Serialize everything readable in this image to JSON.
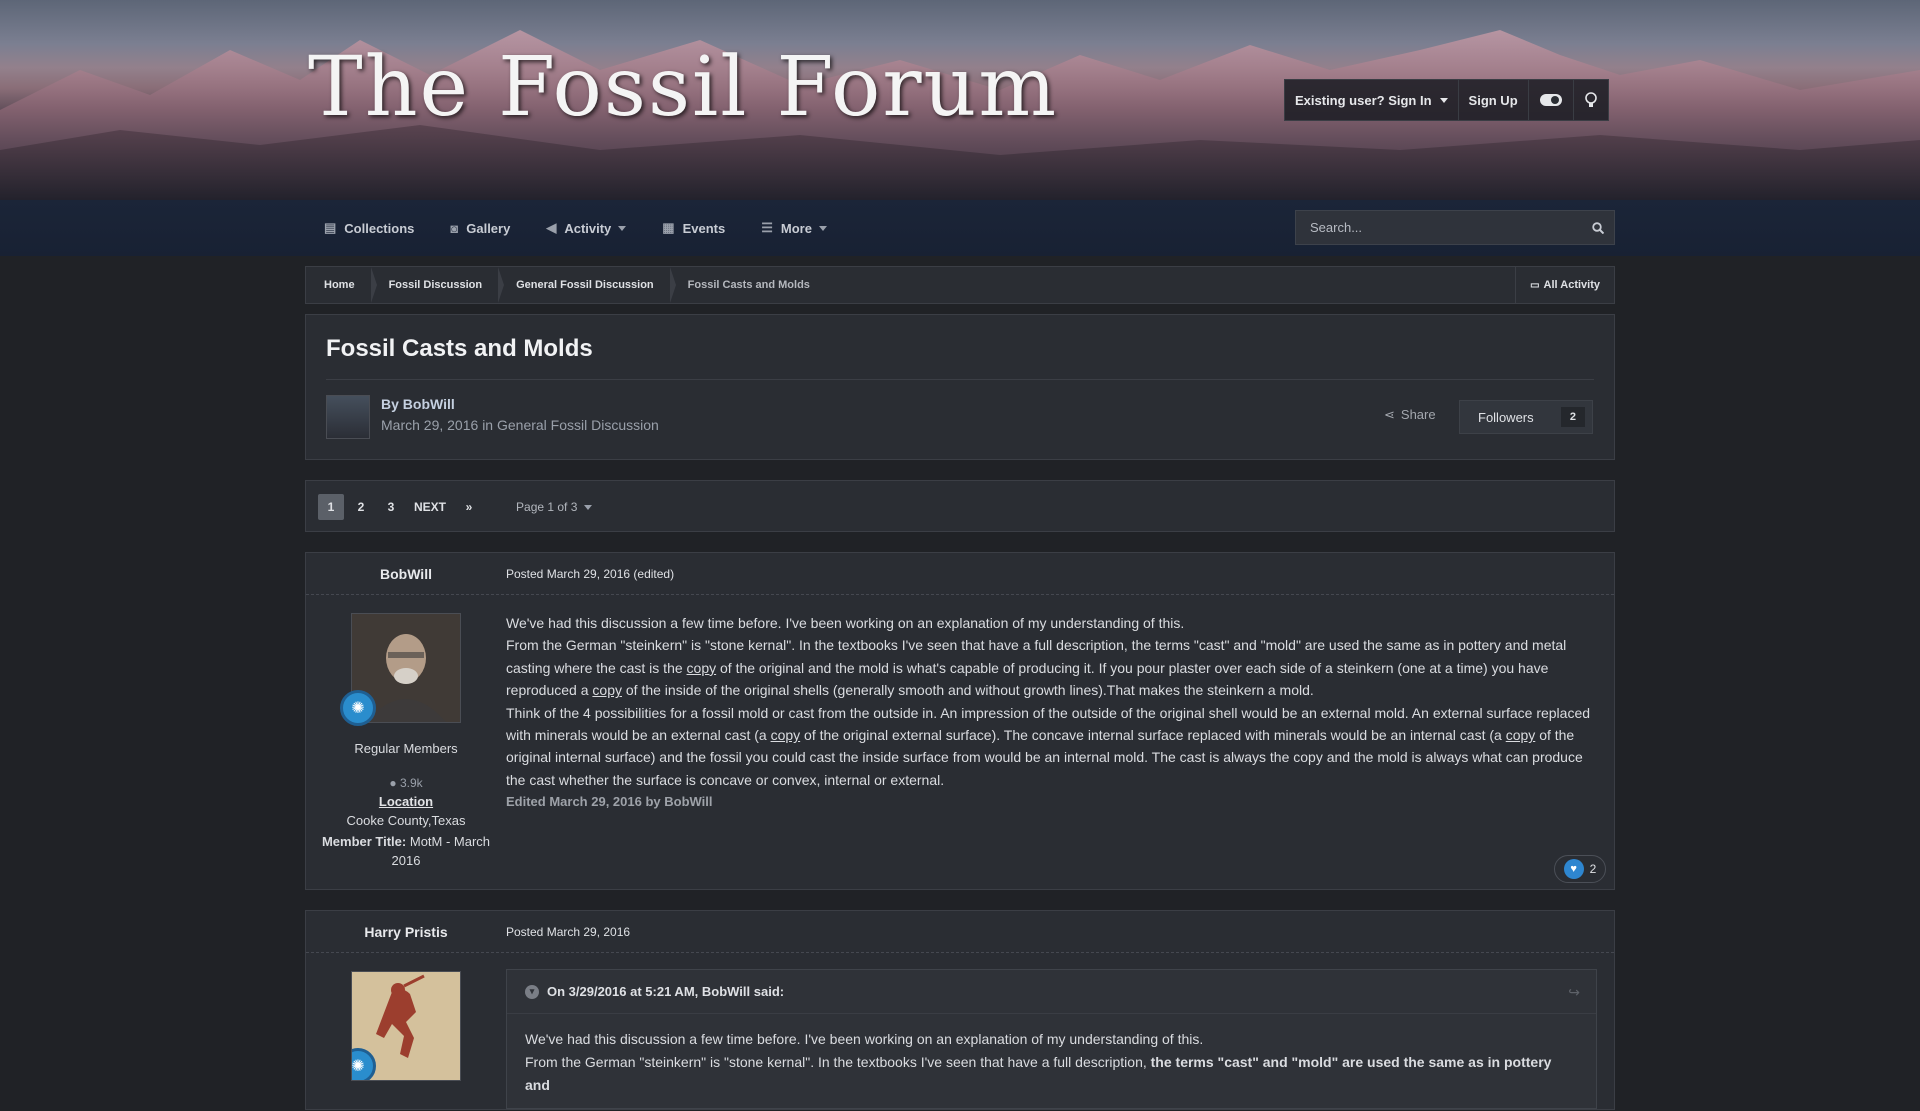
{
  "site": {
    "logo": "The Fossil Forum",
    "user_bar": {
      "sign_in": "Existing user? Sign In",
      "sign_up": "Sign Up"
    }
  },
  "nav": {
    "items": [
      {
        "label": "Collections",
        "icon": "file-icon"
      },
      {
        "label": "Gallery",
        "icon": "camera-icon"
      },
      {
        "label": "Activity",
        "icon": "bullhorn-icon"
      },
      {
        "label": "Events",
        "icon": "calendar-icon"
      },
      {
        "label": "More",
        "icon": "list-icon"
      }
    ],
    "search_placeholder": "Search..."
  },
  "breadcrumb": {
    "items": [
      "Home",
      "Fossil Discussion",
      "General Fossil Discussion",
      "Fossil Casts and Molds"
    ],
    "all_activity": "All Activity"
  },
  "topic": {
    "title": "Fossil Casts and Molds",
    "by_label": "By",
    "author": "BobWill",
    "date": "March 29, 2016",
    "in_label": "in",
    "forum": "General Fossil Discussion",
    "share": "Share",
    "followers_label": "Followers",
    "followers_count": "2"
  },
  "pagination": {
    "pages": [
      "1",
      "2",
      "3"
    ],
    "current": "1",
    "next": "NEXT",
    "page_of": "Page 1 of 3"
  },
  "posts": [
    {
      "author": "BobWill",
      "posted": "Posted March 29, 2016 (edited)",
      "group": "Regular Members",
      "post_count": "3.9k",
      "location_label": "Location",
      "location": "Cooke County,Texas",
      "member_title_label": "Member Title:",
      "member_title": "MotM - March 2016",
      "body": {
        "p1": "We've had this discussion a few time before. I've been working on an explanation of my understanding of this.",
        "p2a": "From the German \"steinkern\" is \"stone kernal\". In the textbooks I've seen that have a full description, the terms \"cast\" and \"mold\" are used the same as in pottery and metal casting where the cast is the",
        "copy": "copy",
        "p2b": "of the original and the mold is what's capable of producing it. If you pour plaster over each side of a steinkern (one at a time) you have reproduced a",
        "p2c": "of the inside of the original shells (generally smooth and without growth lines).That makes the steinkern a mold.",
        "p3a": "Think of the 4 possibilities for a fossil mold or cast from the outside in. An impression of the outside of the original shell would be an external mold. An external surface replaced with minerals would be an external cast (a",
        "p3b": "of the original external surface). The concave internal surface replaced with minerals would be an internal cast (a",
        "p3c": "of the original internal surface) and the fossil you could cast the inside surface from would be an internal mold. The cast is always the copy and the mold is always what can produce the cast whether the surface is concave or convex, internal or external.",
        "edited": "Edited March 29, 2016 by BobWill"
      },
      "reactions": "2"
    },
    {
      "author": "Harry Pristis",
      "posted": "Posted March 29, 2016",
      "quote_header": "On 3/29/2016 at 5:21 AM, BobWill said:",
      "quote_p1": "We've had this discussion a few time before. I've been working on an explanation of my understanding of this.",
      "quote_p2a": "From the German \"steinkern\" is \"stone kernal\". In the textbooks I've seen that have a full description,",
      "quote_p2b": "the terms \"cast\" and \"mold\" are used the same as in pottery and"
    }
  ],
  "colors": {
    "background": "#202226",
    "panel": "#2a2d33",
    "border": "#3b3e45",
    "link": "#c5d0e0",
    "reaction": "#2e86d0"
  }
}
